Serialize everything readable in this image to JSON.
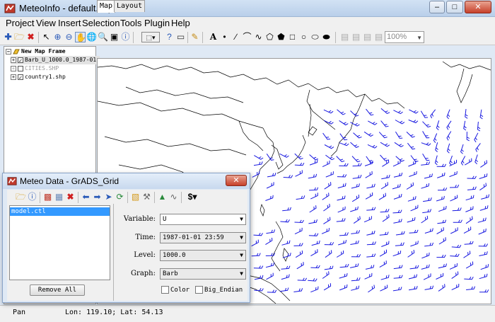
{
  "window": {
    "title": "MeteoInfo - default.mip"
  },
  "menu": [
    "Project",
    "View",
    "Insert",
    "Selection",
    "Tools",
    "Plugin",
    "Help"
  ],
  "toolbar": {
    "zoom": "100%"
  },
  "legend": {
    "frame": "New Map Frame",
    "layers": [
      "Barb_U_1000.0_1987-01-",
      "CITIES.SHP",
      "country1.shp"
    ]
  },
  "tabs": [
    "Map",
    "Layout"
  ],
  "status": {
    "mode": "Pan",
    "coords": "Lon: 119.10; Lat: 54.13"
  },
  "dialog": {
    "title": "Meteo Data - GrADS_Grid",
    "files": [
      "model.ctl"
    ],
    "remove_all": "Remove All",
    "labels": {
      "variable": "Variable:",
      "time": "Time:",
      "level": "Level:",
      "graph": "Graph:"
    },
    "values": {
      "variable": "U",
      "time": "1987-01-01 23:59",
      "level": "1000.0",
      "graph": "Barb"
    },
    "checks": {
      "color": "Color",
      "big_endian": "Big_Endian"
    }
  },
  "colors": {
    "barb": "#1818e0",
    "selection": "#3399ff"
  }
}
